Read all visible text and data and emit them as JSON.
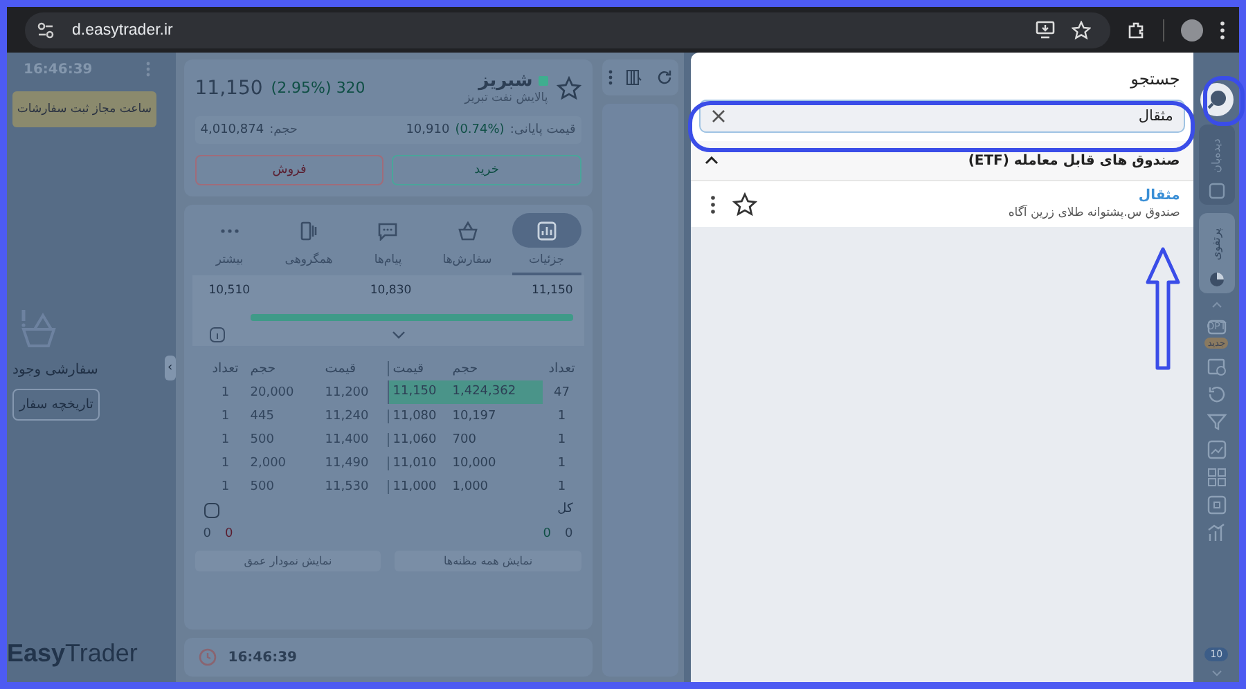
{
  "browser": {
    "url": "d.easytrader.ir"
  },
  "order_panel": {
    "time": "16:46:39",
    "hours_button": "ساعت مجاز ثبت سفارشات",
    "empty_text": "سفارشی وجود",
    "history_button": "تاریخچه سفار",
    "logo": "**Easy**Trader",
    "collapse_glyph": "‹"
  },
  "symbol": {
    "color": "#3fae8f",
    "name": "شبریز",
    "full_name": "پالایش نفت تبریز",
    "price": "11,150",
    "change": "320 (2.95%)",
    "close_label": "قیمت پایانی:",
    "close_price": "10,910",
    "close_change": "(0.74%)",
    "volume_label": "حجم:",
    "volume": "4,010,874",
    "buy": "خرید",
    "sell": "فروش"
  },
  "tabs": [
    {
      "label": "جزئیات",
      "kind": "chart",
      "selected": true
    },
    {
      "label": "سفارش‌ها",
      "kind": "basket",
      "selected": false
    },
    {
      "label": "پیام‌ها",
      "kind": "message",
      "selected": false
    },
    {
      "label": "همگروهی",
      "kind": "group",
      "selected": false
    },
    {
      "label": "بیشتر",
      "kind": "more",
      "selected": false
    }
  ],
  "range": {
    "ticks": [
      "11,150",
      "10,830",
      "10,510"
    ]
  },
  "order_book": {
    "columns": [
      "تعداد",
      "حجم",
      "قیمت",
      "قیمت",
      "حجم",
      "تعداد"
    ],
    "rows": [
      {
        "cells": [
          "47",
          "1,424,362",
          "11,150",
          "11,200",
          "20,000",
          "1"
        ],
        "best": true
      },
      {
        "cells": [
          "1",
          "10,197",
          "11,080",
          "11,240",
          "445",
          "1"
        ],
        "best": false
      },
      {
        "cells": [
          "1",
          "700",
          "11,060",
          "11,400",
          "500",
          "1"
        ],
        "best": false
      },
      {
        "cells": [
          "1",
          "10,000",
          "11,010",
          "11,490",
          "2,000",
          "1"
        ],
        "best": false
      },
      {
        "cells": [
          "1",
          "1,000",
          "11,000",
          "11,530",
          "500",
          "1"
        ],
        "best": false
      }
    ],
    "total_label": "کل",
    "totals": [
      "0",
      "0",
      "0",
      "0"
    ],
    "buttons": [
      "نمایش همه مظنه‌ها",
      "نمایش نمودار عمق"
    ]
  },
  "clock": "16:46:39",
  "search": {
    "title": "جستجو",
    "value": "مثقال",
    "groups": [
      {
        "title": "صندوق های قابل معامله (ETF)",
        "expanded": true,
        "results": [
          {
            "symbol": "مثقال",
            "name": "صندوق س.پشتوانه طلای زرین آگاه"
          }
        ]
      }
    ]
  },
  "sidebar": {
    "tabs": [
      {
        "kind": "search",
        "selected": true
      },
      {
        "kind": "watchlist",
        "label": "دیده‌بان",
        "selected": false
      },
      {
        "kind": "portfolio",
        "label": "پرتفوی",
        "selected": true
      }
    ],
    "tools": [
      {
        "kind": "options",
        "label": "OPT",
        "badge": "جدید"
      },
      {
        "kind": "calendar"
      },
      {
        "kind": "history"
      },
      {
        "kind": "filter"
      },
      {
        "kind": "chart"
      },
      {
        "kind": "grid"
      },
      {
        "kind": "square"
      },
      {
        "kind": "bars"
      }
    ],
    "count_badge": "10"
  }
}
